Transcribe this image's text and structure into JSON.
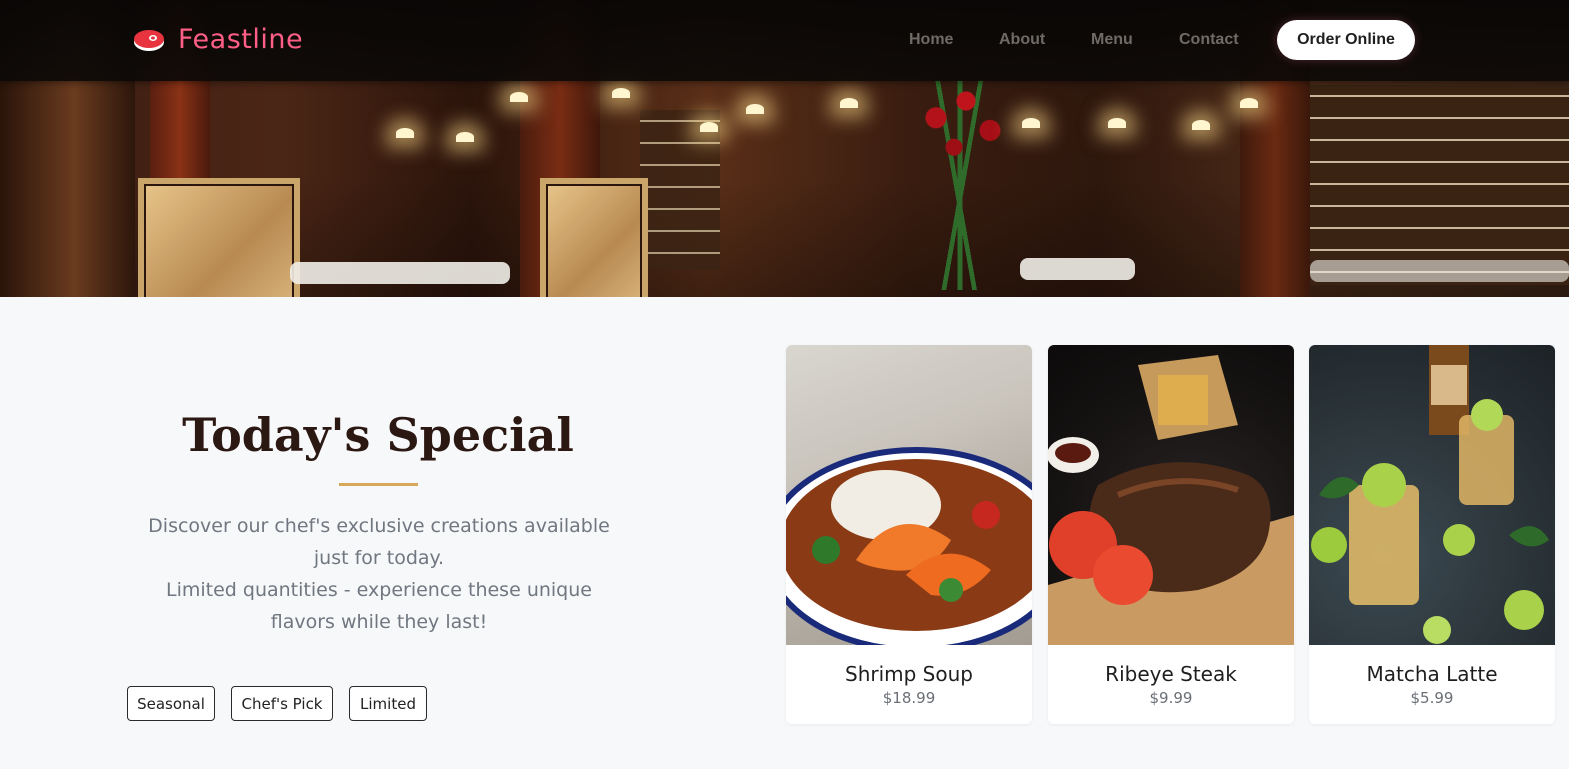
{
  "brand": {
    "name": "Feastline",
    "icon": "steak-icon",
    "color": "#ff5f86"
  },
  "nav": {
    "links": [
      "Home",
      "About",
      "Menu",
      "Contact"
    ],
    "cta": "Order Online"
  },
  "special": {
    "title": "Today's Special",
    "description_line1": "Discover our chef's exclusive creations available just for today.",
    "description_line2": "Limited quantities - experience these unique flavors while they last!",
    "tags": [
      "Seasonal",
      "Chef's Pick",
      "Limited"
    ],
    "accent": "#d6a85a"
  },
  "items": [
    {
      "name": "Shrimp Soup",
      "price": "$18.99"
    },
    {
      "name": "Ribeye Steak",
      "price": "$9.99"
    },
    {
      "name": "Matcha Latte",
      "price": "$5.99"
    }
  ]
}
